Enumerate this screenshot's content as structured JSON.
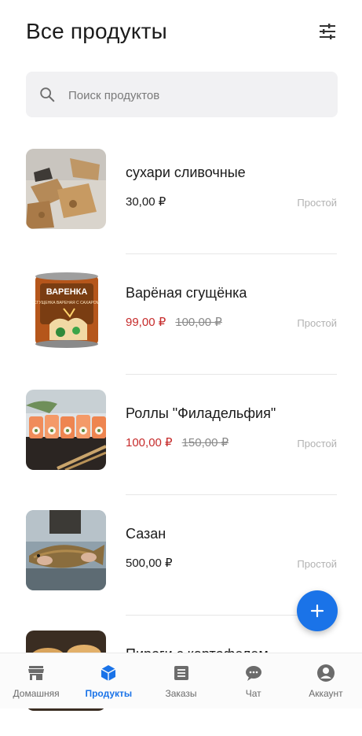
{
  "header": {
    "title": "Все продукты",
    "filter_icon": "tune-icon"
  },
  "search": {
    "placeholder": "Поиск продуктов",
    "icon": "search-icon"
  },
  "products": [
    {
      "name": "сухари сливочные",
      "price": "30,00 ₽",
      "old_price": "",
      "type": "Простой",
      "image": "crackers"
    },
    {
      "name": "Варёная сгущёнка",
      "price": "99,00 ₽",
      "old_price": "100,00 ₽",
      "type": "Простой",
      "image": "condensed-milk-can"
    },
    {
      "name": "Роллы \"Филадельфия\"",
      "price": "100,00 ₽",
      "old_price": "150,00 ₽",
      "type": "Простой",
      "image": "sushi-rolls"
    },
    {
      "name": "Сазан",
      "price": "500,00 ₽",
      "old_price": "",
      "type": "Простой",
      "image": "carp-fish"
    },
    {
      "name": "Пироги с картофелем",
      "price": "",
      "old_price": "",
      "type": "",
      "image": "pies"
    }
  ],
  "fab": {
    "icon": "plus-icon"
  },
  "nav": [
    {
      "label": "Домашняя",
      "icon": "store-icon",
      "active": false
    },
    {
      "label": "Продукты",
      "icon": "box-icon",
      "active": true
    },
    {
      "label": "Заказы",
      "icon": "orders-icon",
      "active": false
    },
    {
      "label": "Чат",
      "icon": "chat-icon",
      "active": false
    },
    {
      "label": "Аккаунт",
      "icon": "account-icon",
      "active": false
    }
  ],
  "colors": {
    "accent": "#1a73e8",
    "sale": "#c62b2b",
    "muted": "#b2b2b2"
  },
  "can_label": {
    "line1": "ВАРЕНКА",
    "line2": "СГУЩЕНКА ВАРЕНАЯ С САХАРОМ"
  }
}
